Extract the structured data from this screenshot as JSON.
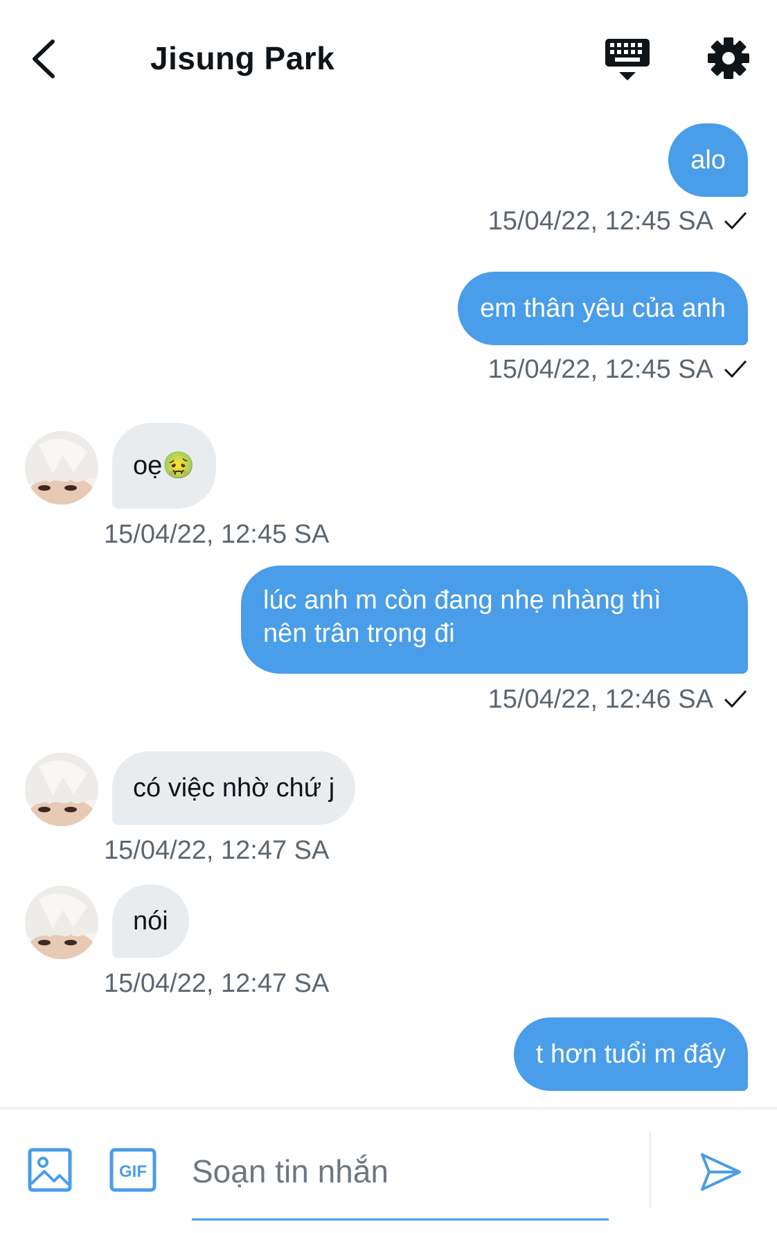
{
  "header": {
    "title": "Jisung Park",
    "back_icon": "chevron-left-icon",
    "keyboard_icon": "keyboard-hide-icon",
    "settings_icon": "gear-icon"
  },
  "messages": [
    {
      "direction": "out",
      "text": "alo",
      "time": "15/04/22, 12:45 SA",
      "status": "sent"
    },
    {
      "direction": "out",
      "text": "em thân yêu của anh",
      "time": "15/04/22, 12:45 SA",
      "status": "sent"
    },
    {
      "direction": "in",
      "text": "oẹ🤢",
      "time": "15/04/22, 12:45 SA"
    },
    {
      "direction": "out",
      "text_line1": "lúc anh m còn đang nhẹ nhàng thì",
      "text_line2": "nên trân trọng đi",
      "time": "15/04/22, 12:46 SA",
      "status": "sent"
    },
    {
      "direction": "in",
      "text": "có việc nhờ chứ j",
      "time": "15/04/22, 12:47 SA"
    },
    {
      "direction": "in",
      "text": "nói",
      "time": "15/04/22, 12:47 SA"
    },
    {
      "direction": "out",
      "text": "t hơn tuổi m đấy"
    }
  ],
  "composer": {
    "placeholder": "Soạn tin nhắn",
    "value": "",
    "gif_label": "GIF",
    "image_icon": "image-icon",
    "send_icon": "send-icon"
  },
  "colors": {
    "accent": "#4a9de8",
    "incoming_bubble": "#e9ecef",
    "timestamp": "#5b6670"
  }
}
